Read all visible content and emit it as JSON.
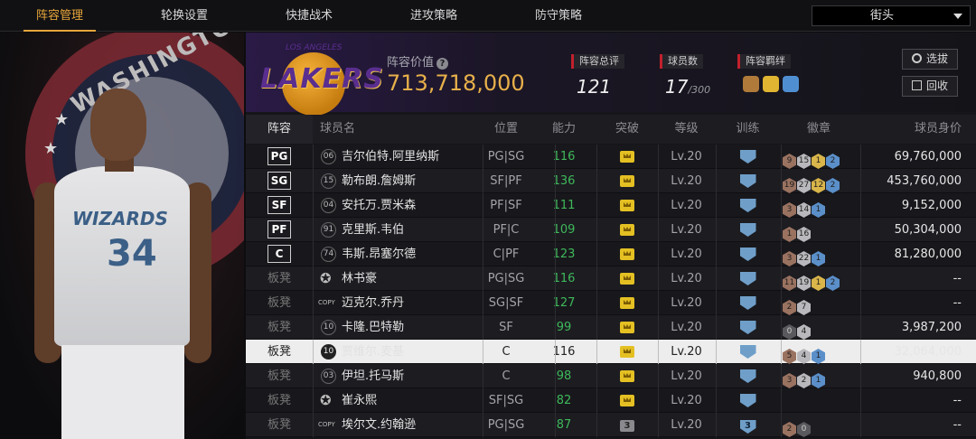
{
  "nav": {
    "tabs": [
      "阵容管理",
      "轮换设置",
      "快捷战术",
      "进攻策略",
      "防守策略"
    ],
    "active_tab": 0,
    "mode_select": "街头"
  },
  "player_panel": {
    "team_city": "WASHINGTON",
    "jersey_name": "WIZARDS",
    "jersey_number": "34"
  },
  "summary": {
    "team_logo_text": "LAKERS",
    "team_logo_small": "LOS ANGELES",
    "value_label": "阵容价值",
    "value": "713,718,000",
    "rating_label": "阵容总评",
    "rating": "121",
    "count_label": "球员数",
    "count": "17",
    "count_max": "/300",
    "bond_label": "阵容羁绊",
    "buttons": {
      "select": "选拔",
      "recycle": "回收"
    }
  },
  "table": {
    "headers": {
      "lineup": "阵容",
      "name": "球员名",
      "position": "位置",
      "ability": "能力",
      "breakthrough": "突破",
      "level": "等级",
      "training": "训练",
      "badges": "徽章",
      "price": "球员身价"
    },
    "rows": [
      {
        "slot": "PG",
        "jersey": "06",
        "name": "吉尔伯特.阿里纳斯",
        "pos": "PG|SG",
        "ovr": "116",
        "brk": "crown",
        "lvl": "Lv.20",
        "trn": "",
        "badges": [
          [
            "bronze",
            "9"
          ],
          [
            "silver",
            "15"
          ],
          [
            "gold",
            "1"
          ],
          [
            "blue",
            "2"
          ]
        ],
        "price": "69,760,000"
      },
      {
        "slot": "SG",
        "jersey": "15",
        "name": "勒布朗.詹姆斯",
        "pos": "SF|PF",
        "ovr": "136",
        "brk": "crown",
        "lvl": "Lv.20",
        "trn": "",
        "badges": [
          [
            "bronze",
            "19"
          ],
          [
            "silver",
            "27"
          ],
          [
            "gold",
            "12"
          ],
          [
            "blue",
            "2"
          ]
        ],
        "price": "453,760,000"
      },
      {
        "slot": "SF",
        "jersey": "04",
        "name": "安托万.贾米森",
        "pos": "PF|SF",
        "ovr": "111",
        "brk": "crown",
        "lvl": "Lv.20",
        "trn": "",
        "badges": [
          [
            "bronze",
            "3"
          ],
          [
            "silver",
            "14"
          ],
          [
            "blue",
            "1"
          ]
        ],
        "price": "9,152,000"
      },
      {
        "slot": "PF",
        "jersey": "91",
        "name": "克里斯.韦伯",
        "pos": "PF|C",
        "ovr": "109",
        "brk": "crown",
        "lvl": "Lv.20",
        "trn": "",
        "badges": [
          [
            "bronze",
            "1"
          ],
          [
            "silver",
            "16"
          ]
        ],
        "price": "50,304,000"
      },
      {
        "slot": "C",
        "jersey": "74",
        "name": "韦斯.昂塞尔德",
        "pos": "C|PF",
        "ovr": "123",
        "brk": "crown",
        "lvl": "Lv.20",
        "trn": "",
        "badges": [
          [
            "bronze",
            "3"
          ],
          [
            "silver",
            "22"
          ],
          [
            "blue",
            "1"
          ]
        ],
        "price": "81,280,000"
      },
      {
        "slot": "板凳",
        "jersey": "star",
        "name": "林书豪",
        "pos": "PG|SG",
        "ovr": "116",
        "brk": "crown",
        "lvl": "Lv.20",
        "trn": "",
        "badges": [
          [
            "bronze",
            "11"
          ],
          [
            "silver",
            "19"
          ],
          [
            "gold",
            "1"
          ],
          [
            "blue",
            "2"
          ]
        ],
        "price": "--"
      },
      {
        "slot": "板凳",
        "jersey": "copy",
        "name": "迈克尔.乔丹",
        "pos": "SG|SF",
        "ovr": "127",
        "brk": "crown",
        "lvl": "Lv.20",
        "trn": "",
        "badges": [
          [
            "bronze",
            "2"
          ],
          [
            "silver",
            "7"
          ]
        ],
        "price": "--"
      },
      {
        "slot": "板凳",
        "jersey": "10",
        "name": "卡隆.巴特勒",
        "pos": "SF",
        "ovr": "99",
        "brk": "crown",
        "lvl": "Lv.20",
        "trn": "",
        "badges": [
          [
            "dark",
            "0"
          ],
          [
            "silver",
            "4"
          ]
        ],
        "price": "3,987,200"
      },
      {
        "slot": "板凳",
        "jersey": "10",
        "name": "贾维尔.麦基",
        "pos": "C",
        "ovr": "116",
        "brk": "crown",
        "lvl": "Lv.20",
        "trn": "",
        "badges": [
          [
            "bronze",
            "5"
          ],
          [
            "silver",
            "4"
          ],
          [
            "blue",
            "1"
          ]
        ],
        "price": "32,064,000",
        "selected": true
      },
      {
        "slot": "板凳",
        "jersey": "03",
        "name": "伊坦.托马斯",
        "pos": "C",
        "ovr": "98",
        "brk": "crown",
        "lvl": "Lv.20",
        "trn": "",
        "badges": [
          [
            "bronze",
            "3"
          ],
          [
            "silver",
            "2"
          ],
          [
            "blue",
            "1"
          ]
        ],
        "price": "940,800"
      },
      {
        "slot": "板凳",
        "jersey": "star",
        "name": "崔永熙",
        "pos": "SF|SG",
        "ovr": "82",
        "brk": "crown",
        "lvl": "Lv.20",
        "trn": "",
        "badges": [],
        "price": "--"
      },
      {
        "slot": "板凳",
        "jersey": "copy",
        "name": "埃尔文.约翰逊",
        "pos": "PG|SG",
        "ovr": "87",
        "brk": "3",
        "lvl": "Lv.20",
        "trn": "3",
        "badges": [
          [
            "bronze",
            "2"
          ],
          [
            "dark",
            "0"
          ]
        ],
        "price": "--"
      }
    ]
  },
  "colors": {
    "accent": "#e7a63a",
    "ability_green": "#3fb85a",
    "lakers_purple": "#5a2e8f",
    "selected_row": "#ededed"
  }
}
